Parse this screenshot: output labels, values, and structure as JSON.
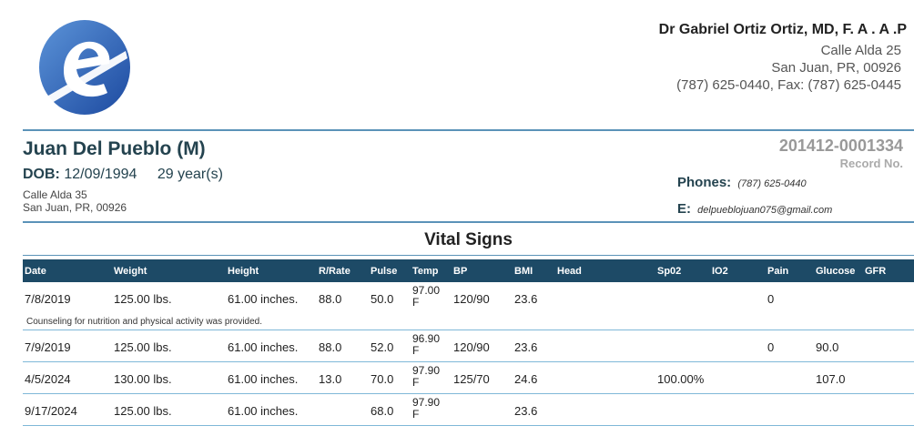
{
  "doctor": {
    "name": "Dr Gabriel Ortiz Ortiz, MD, F. A . A .P",
    "address_line1": "Calle Alda 25",
    "address_line2": "San Juan, PR, 00926",
    "contact": "(787) 625-0440, Fax: (787) 625-0445"
  },
  "patient": {
    "name": "Juan Del Pueblo (M)",
    "dob_label": "DOB:",
    "dob": "12/09/1994",
    "age": "29 year(s)",
    "address_line1": "Calle Alda 35",
    "address_line2": "San Juan, PR, 00926",
    "phones_label": "Phones:",
    "phone": "(787) 625-0440",
    "email_label": "E:",
    "email": "delpueblojuan075@gmail.com"
  },
  "record": {
    "id": "201412-0001334",
    "label": "Record No."
  },
  "vitals": {
    "title": "Vital Signs",
    "headers": {
      "date": "Date",
      "weight": "Weight",
      "height": "Height",
      "rr": "R/Rate",
      "pulse": "Pulse",
      "temp": "Temp",
      "bp": "BP",
      "bmi": "BMI",
      "head": "Head",
      "sp02": "Sp02",
      "io2": "IO2",
      "pain": "Pain",
      "glucose": "Glucose",
      "gfr": "GFR"
    },
    "rows": [
      {
        "date": "7/8/2019",
        "weight": "125.00 lbs.",
        "height": "61.00 inches.",
        "rr": "88.0",
        "pulse": "50.0",
        "temp_value": "97.00",
        "temp_unit": "F",
        "bp": "120/90",
        "bmi": "23.6",
        "sp02": "",
        "pain": "0",
        "glucose": ""
      },
      {
        "date": "7/9/2019",
        "weight": "125.00 lbs.",
        "height": "61.00 inches.",
        "rr": "88.0",
        "pulse": "52.0",
        "temp_value": "96.90",
        "temp_unit": "F",
        "bp": "120/90",
        "bmi": "23.6",
        "sp02": "",
        "pain": "0",
        "glucose": "90.0"
      },
      {
        "date": "4/5/2024",
        "weight": "130.00 lbs.",
        "height": "61.00 inches.",
        "rr": "13.0",
        "pulse": "70.0",
        "temp_value": "97.90",
        "temp_unit": "F",
        "bp": "125/70",
        "bmi": "24.6",
        "sp02": "100.00%",
        "pain": "",
        "glucose": "107.0"
      },
      {
        "date": "9/17/2024",
        "weight": "125.00 lbs.",
        "height": "61.00 inches.",
        "rr": "",
        "pulse": "68.0",
        "temp_value": "97.90",
        "temp_unit": "F",
        "bp": "",
        "bmi": "23.6",
        "sp02": "",
        "pain": "",
        "glucose": ""
      }
    ],
    "note": "Counseling for nutrition and physical activity was provided."
  },
  "colors": {
    "header_bg": "#1d4a66",
    "rule": "#5b93b8",
    "row_divider": "#7fb8d8",
    "logo_blue": "#2f66b8"
  }
}
